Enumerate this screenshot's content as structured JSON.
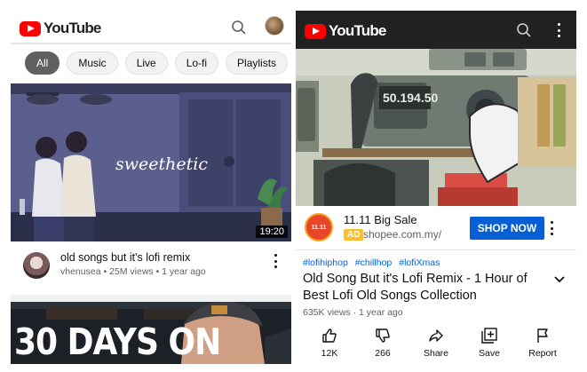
{
  "left_panel": {
    "logo_text": "YouTube",
    "chips": [
      "All",
      "Music",
      "Live",
      "Lo-fi",
      "Playlists",
      "C"
    ],
    "video1": {
      "thumbnail_text": "sweethetic",
      "duration": "19:20",
      "title": "old songs but it's lofi remix",
      "subtitle": "vhenusea • 25M views • 1 year ago"
    },
    "video2": {
      "thumbnail_text": "30 DAYS ON"
    }
  },
  "right_panel": {
    "logo_text": "YouTube",
    "player_display": "50.194.50",
    "ad": {
      "logo_text": "11.11",
      "title": "11.11 Big Sale",
      "badge": "AD",
      "url": "shopee.com.my/",
      "cta": "SHOP NOW"
    },
    "hashtags": [
      "#lofihiphop",
      "#chillhop",
      "#lofiXmas"
    ],
    "title": "Old Song But it's Lofi Remix - 1 Hour of Best Lofi Old Songs Collection",
    "subtitle": "635K views · 1 year ago",
    "actions": [
      {
        "icon": "thumb-up-icon",
        "label": "12K"
      },
      {
        "icon": "thumb-down-icon",
        "label": "266"
      },
      {
        "icon": "share-icon",
        "label": "Share"
      },
      {
        "icon": "save-icon",
        "label": "Save"
      },
      {
        "icon": "flag-icon",
        "label": "Report"
      }
    ]
  },
  "colors": {
    "brand_red": "#ff0000",
    "dark_header": "#212121",
    "link_blue": "#065fd4",
    "ad_badge": "#fbc02d"
  }
}
